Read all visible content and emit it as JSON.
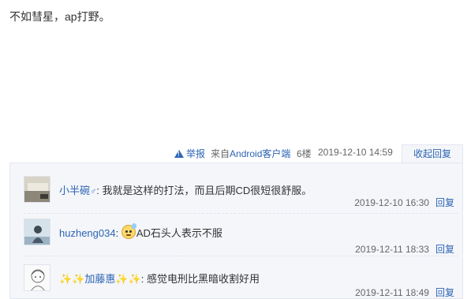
{
  "post": {
    "text": "不如彗星，ap打野。"
  },
  "meta": {
    "report_label": "举报",
    "source_prefix": "来自",
    "source_app": "Android客户端",
    "floor": "6楼",
    "timestamp": "2019-12-10 14:59",
    "collapse_label": "收起回复"
  },
  "replies": [
    {
      "user": "小半碗",
      "gender_mark": "♂",
      "separator": ":",
      "text": " 我就是这样的打法，而且后期CD很短很舒服。",
      "time": "2019-12-10 16:30",
      "reply_label": "回复"
    },
    {
      "user": "huzheng034",
      "separator": ":",
      "emoji": "sweat-smile-emoji",
      "text": "AD石头人表示不服",
      "time": "2019-12-11 18:33",
      "reply_label": "回复"
    },
    {
      "user_prefix": "✨✨",
      "user": "加藤惠",
      "user_suffix": "✨✨",
      "separator": ":",
      "text": " 感觉电刑比黑暗收割好用",
      "time": "2019-12-11 18:49",
      "reply_label": "回复"
    }
  ],
  "colors": {
    "link": "#2d64b3",
    "panel_bg": "#f4f6fa",
    "border": "#e3e6ee"
  }
}
